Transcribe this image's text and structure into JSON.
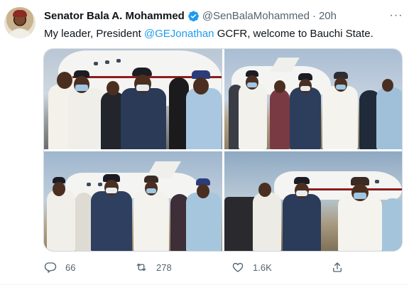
{
  "tweet": {
    "author_name": "Senator Bala A. Mohammed",
    "handle": "@SenBalaMohammed",
    "separator": "·",
    "time": "20h",
    "more_label": "···",
    "text_before": "My leader, President ",
    "mention": "@GEJonathan",
    "text_after": " GCFR, welcome to Bauchi State."
  },
  "actions": {
    "replies": "66",
    "retweets": "278",
    "likes": "1.6K"
  },
  "icons": {
    "verified": "verified-badge-icon",
    "more": "more-icon",
    "reply": "reply-icon",
    "retweet": "retweet-icon",
    "like": "like-icon",
    "share": "share-icon"
  },
  "colors": {
    "accent": "#1d9bf0",
    "text": "#0f1419",
    "secondary": "#536471",
    "border": "#cfd9de"
  }
}
